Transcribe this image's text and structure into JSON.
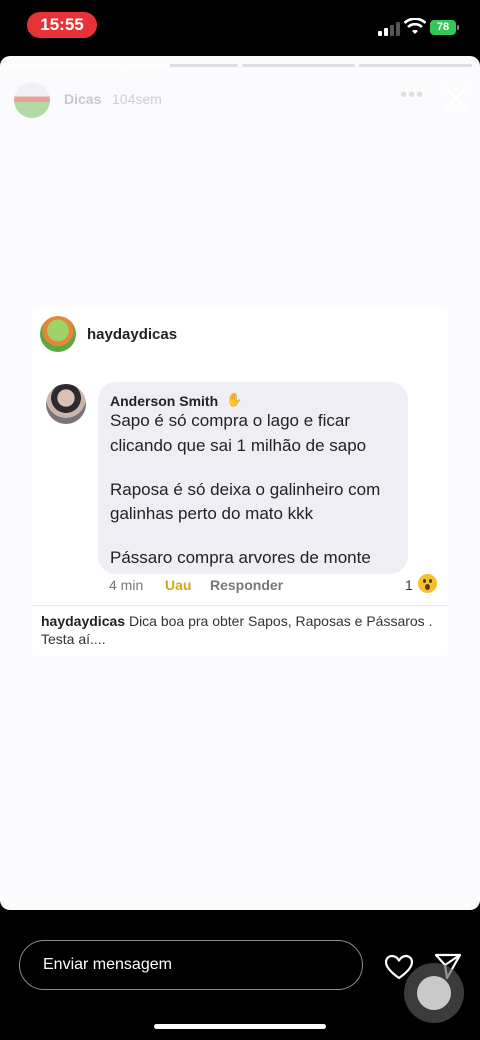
{
  "status_bar": {
    "time": "15:55",
    "battery": "78"
  },
  "story": {
    "progress": {
      "segments": 4,
      "done": 1,
      "active_fraction": 0.4
    },
    "account_name": "Dicas",
    "time_ago": "104sem",
    "more_label": "•••"
  },
  "post": {
    "author": "haydaydicas",
    "comment": {
      "user": "Anderson Smith",
      "lines": [
        "Sapo é só compra o lago e ficar",
        "clicando que sai 1 milhão de sapo",
        "Raposa é só deixa o galinheiro com",
        "galinhas perto do mato kkk",
        "Pássaro compra arvores de monte"
      ],
      "time": "4 min",
      "reaction_label": "Uau",
      "reply_label": "Responder",
      "reaction_count": "1"
    },
    "caption_user": "haydaydicas",
    "caption_text": "Dica boa pra obter Sapos, Raposas e Pássaros . Testa aí...."
  },
  "footer": {
    "message_placeholder": "Enviar mensagem"
  }
}
